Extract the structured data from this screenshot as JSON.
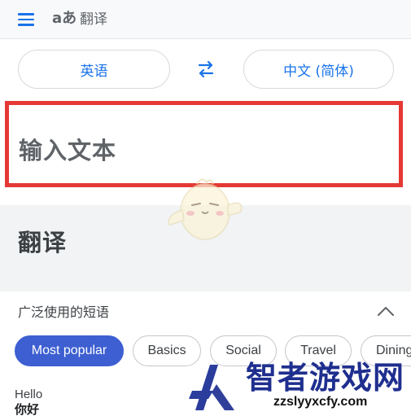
{
  "header": {
    "menu_icon": "menu-icon",
    "logo_text": "aあ",
    "title": "翻译",
    "accent_color": "#1a73e8"
  },
  "languages": {
    "source": "英语",
    "target": "中文 (简体)",
    "swap_icon": "swap-arrows-icon"
  },
  "input": {
    "placeholder": "输入文本",
    "highlight_color": "#e53935"
  },
  "output": {
    "label": "翻译"
  },
  "phrases": {
    "title": "广泛使用的短语",
    "collapse_icon": "chevron-up-icon",
    "chips": [
      {
        "label": "Most popular",
        "active": true
      },
      {
        "label": "Basics",
        "active": false
      },
      {
        "label": "Social",
        "active": false
      },
      {
        "label": "Travel",
        "active": false
      },
      {
        "label": "Dining",
        "active": false
      }
    ],
    "items": [
      {
        "source": "Hello",
        "translation": "你好"
      }
    ]
  },
  "watermark": {
    "title": "智者游戏网",
    "url": "zzslyyxcfy.com",
    "brand_color": "#1f2f8f"
  }
}
